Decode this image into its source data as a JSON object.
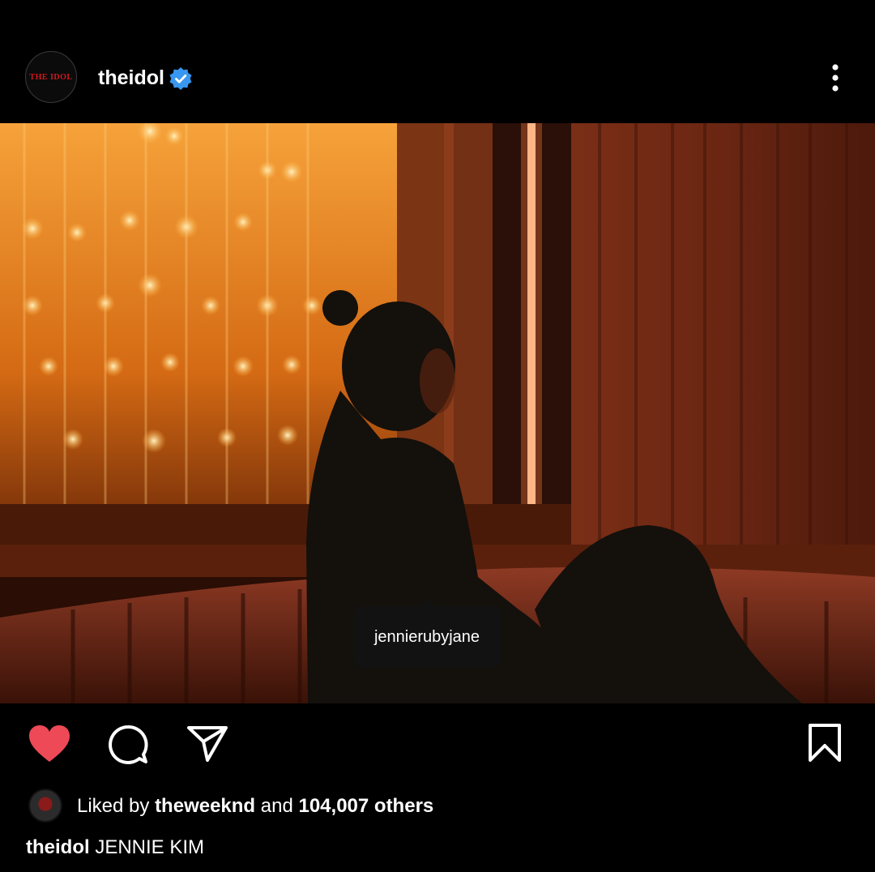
{
  "post": {
    "avatar_text": "THE IDOL",
    "username": "theidol",
    "verified": true,
    "more_icon": "more-vertical-icon",
    "tag_username": "jennierubyjane",
    "liked_prefix": "Liked by",
    "liked_by": "theweeknd",
    "liked_and": "and",
    "liked_count": "104,007 others",
    "caption_user": "theidol",
    "caption_text": "JENNIE KIM",
    "liked": true,
    "colors": {
      "background": "#000000",
      "heart": "#ed4956",
      "verified": "#3897f0",
      "avatar_text": "#d3161d"
    }
  }
}
